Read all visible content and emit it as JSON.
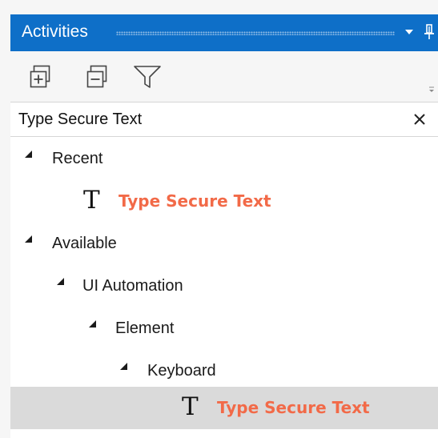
{
  "panel": {
    "title": "Activities",
    "accent_color": "#0e6fc8",
    "menu_icon": "dropdown-arrow-icon",
    "pin_icon": "pin-icon"
  },
  "toolbar": {
    "expand_icon": "expand-all-icon",
    "collapse_icon": "collapse-all-icon",
    "filter_icon": "filter-icon",
    "overflow_icon": "overflow-icon"
  },
  "search": {
    "value": "Type Secure Text",
    "clear_icon": "close-icon"
  },
  "tree": {
    "highlight_color": "#f26a48",
    "recent": {
      "label": "Recent",
      "items": [
        {
          "icon": "T",
          "label": "Type Secure Text"
        }
      ]
    },
    "available": {
      "label": "Available",
      "ui_automation": {
        "label": "UI Automation",
        "element": {
          "label": "Element",
          "keyboard": {
            "label": "Keyboard",
            "items": [
              {
                "icon": "T",
                "label": "Type Secure Text",
                "selected": true
              }
            ]
          }
        }
      }
    }
  }
}
